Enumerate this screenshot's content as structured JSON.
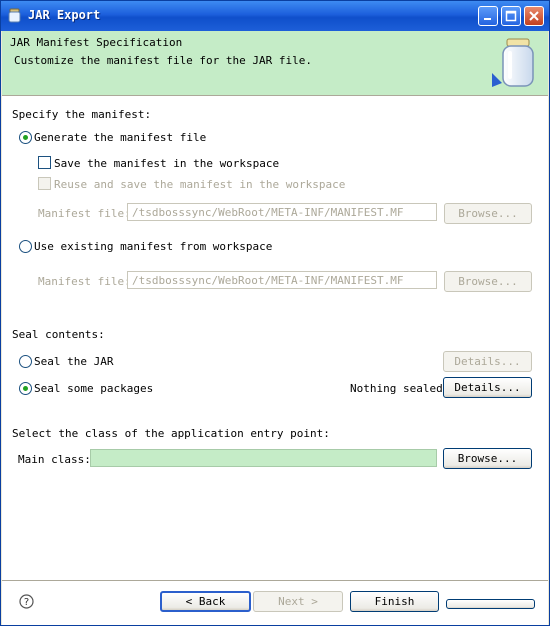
{
  "window": {
    "title": "JAR Export",
    "icon": "jar-icon"
  },
  "header": {
    "title": "JAR Manifest Specification",
    "subtitle": "Customize the manifest file for the JAR file."
  },
  "manifest": {
    "section_label": "Specify the manifest:",
    "generate": {
      "label": "Generate the manifest file",
      "checked": true
    },
    "save_in_workspace": {
      "label": "Save the manifest in the workspace",
      "checked": false
    },
    "reuse": {
      "label": "Reuse and save the manifest in the workspace",
      "enabled": false
    },
    "generated_file": {
      "label": "Manifest file:",
      "value": "/tsdbosssync/WebRoot/META-INF/MANIFEST.MF",
      "browse_label": "Browse..."
    },
    "use_existing": {
      "label": "Use existing manifest from workspace",
      "checked": false
    },
    "existing_file": {
      "label": "Manifest file:",
      "value": "/tsdbosssync/WebRoot/META-INF/MANIFEST.MF",
      "browse_label": "Browse..."
    }
  },
  "seal": {
    "section_label": "Seal contents:",
    "seal_jar": {
      "label": "Seal the JAR",
      "details_label": "Details..."
    },
    "seal_packages": {
      "label": "Seal some packages",
      "status": "Nothing sealed",
      "details_label": "Details..."
    }
  },
  "entry_point": {
    "section_label": "Select the class of the application entry point:",
    "main_class_label": "Main class:",
    "main_class_value": "",
    "browse_label": "Browse..."
  },
  "footer": {
    "back_label": "< Back",
    "next_label": "Next >",
    "finish_label": "Finish",
    "cancel_label": ""
  },
  "colors": {
    "header_bg": "#c5ecc7",
    "title_bar": "#1c5fdc",
    "radio_dot": "#21a121"
  }
}
